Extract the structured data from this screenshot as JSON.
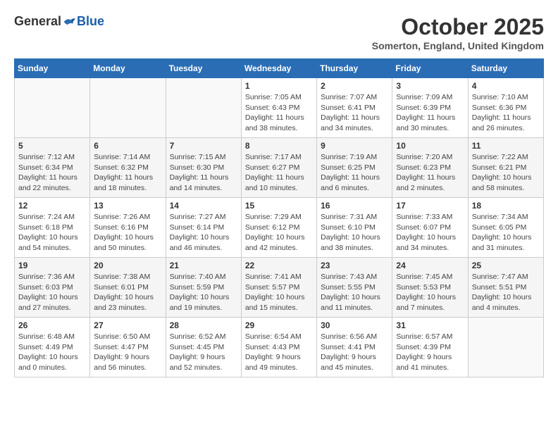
{
  "header": {
    "logo": {
      "general": "General",
      "blue": "Blue"
    },
    "title": "October 2025",
    "location": "Somerton, England, United Kingdom"
  },
  "weekdays": [
    "Sunday",
    "Monday",
    "Tuesday",
    "Wednesday",
    "Thursday",
    "Friday",
    "Saturday"
  ],
  "weeks": [
    [
      {
        "day": "",
        "info": ""
      },
      {
        "day": "",
        "info": ""
      },
      {
        "day": "",
        "info": ""
      },
      {
        "day": "1",
        "info": "Sunrise: 7:05 AM\nSunset: 6:43 PM\nDaylight: 11 hours\nand 38 minutes."
      },
      {
        "day": "2",
        "info": "Sunrise: 7:07 AM\nSunset: 6:41 PM\nDaylight: 11 hours\nand 34 minutes."
      },
      {
        "day": "3",
        "info": "Sunrise: 7:09 AM\nSunset: 6:39 PM\nDaylight: 11 hours\nand 30 minutes."
      },
      {
        "day": "4",
        "info": "Sunrise: 7:10 AM\nSunset: 6:36 PM\nDaylight: 11 hours\nand 26 minutes."
      }
    ],
    [
      {
        "day": "5",
        "info": "Sunrise: 7:12 AM\nSunset: 6:34 PM\nDaylight: 11 hours\nand 22 minutes."
      },
      {
        "day": "6",
        "info": "Sunrise: 7:14 AM\nSunset: 6:32 PM\nDaylight: 11 hours\nand 18 minutes."
      },
      {
        "day": "7",
        "info": "Sunrise: 7:15 AM\nSunset: 6:30 PM\nDaylight: 11 hours\nand 14 minutes."
      },
      {
        "day": "8",
        "info": "Sunrise: 7:17 AM\nSunset: 6:27 PM\nDaylight: 11 hours\nand 10 minutes."
      },
      {
        "day": "9",
        "info": "Sunrise: 7:19 AM\nSunset: 6:25 PM\nDaylight: 11 hours\nand 6 minutes."
      },
      {
        "day": "10",
        "info": "Sunrise: 7:20 AM\nSunset: 6:23 PM\nDaylight: 11 hours\nand 2 minutes."
      },
      {
        "day": "11",
        "info": "Sunrise: 7:22 AM\nSunset: 6:21 PM\nDaylight: 10 hours\nand 58 minutes."
      }
    ],
    [
      {
        "day": "12",
        "info": "Sunrise: 7:24 AM\nSunset: 6:18 PM\nDaylight: 10 hours\nand 54 minutes."
      },
      {
        "day": "13",
        "info": "Sunrise: 7:26 AM\nSunset: 6:16 PM\nDaylight: 10 hours\nand 50 minutes."
      },
      {
        "day": "14",
        "info": "Sunrise: 7:27 AM\nSunset: 6:14 PM\nDaylight: 10 hours\nand 46 minutes."
      },
      {
        "day": "15",
        "info": "Sunrise: 7:29 AM\nSunset: 6:12 PM\nDaylight: 10 hours\nand 42 minutes."
      },
      {
        "day": "16",
        "info": "Sunrise: 7:31 AM\nSunset: 6:10 PM\nDaylight: 10 hours\nand 38 minutes."
      },
      {
        "day": "17",
        "info": "Sunrise: 7:33 AM\nSunset: 6:07 PM\nDaylight: 10 hours\nand 34 minutes."
      },
      {
        "day": "18",
        "info": "Sunrise: 7:34 AM\nSunset: 6:05 PM\nDaylight: 10 hours\nand 31 minutes."
      }
    ],
    [
      {
        "day": "19",
        "info": "Sunrise: 7:36 AM\nSunset: 6:03 PM\nDaylight: 10 hours\nand 27 minutes."
      },
      {
        "day": "20",
        "info": "Sunrise: 7:38 AM\nSunset: 6:01 PM\nDaylight: 10 hours\nand 23 minutes."
      },
      {
        "day": "21",
        "info": "Sunrise: 7:40 AM\nSunset: 5:59 PM\nDaylight: 10 hours\nand 19 minutes."
      },
      {
        "day": "22",
        "info": "Sunrise: 7:41 AM\nSunset: 5:57 PM\nDaylight: 10 hours\nand 15 minutes."
      },
      {
        "day": "23",
        "info": "Sunrise: 7:43 AM\nSunset: 5:55 PM\nDaylight: 10 hours\nand 11 minutes."
      },
      {
        "day": "24",
        "info": "Sunrise: 7:45 AM\nSunset: 5:53 PM\nDaylight: 10 hours\nand 7 minutes."
      },
      {
        "day": "25",
        "info": "Sunrise: 7:47 AM\nSunset: 5:51 PM\nDaylight: 10 hours\nand 4 minutes."
      }
    ],
    [
      {
        "day": "26",
        "info": "Sunrise: 6:48 AM\nSunset: 4:49 PM\nDaylight: 10 hours\nand 0 minutes."
      },
      {
        "day": "27",
        "info": "Sunrise: 6:50 AM\nSunset: 4:47 PM\nDaylight: 9 hours\nand 56 minutes."
      },
      {
        "day": "28",
        "info": "Sunrise: 6:52 AM\nSunset: 4:45 PM\nDaylight: 9 hours\nand 52 minutes."
      },
      {
        "day": "29",
        "info": "Sunrise: 6:54 AM\nSunset: 4:43 PM\nDaylight: 9 hours\nand 49 minutes."
      },
      {
        "day": "30",
        "info": "Sunrise: 6:56 AM\nSunset: 4:41 PM\nDaylight: 9 hours\nand 45 minutes."
      },
      {
        "day": "31",
        "info": "Sunrise: 6:57 AM\nSunset: 4:39 PM\nDaylight: 9 hours\nand 41 minutes."
      },
      {
        "day": "",
        "info": ""
      }
    ]
  ]
}
